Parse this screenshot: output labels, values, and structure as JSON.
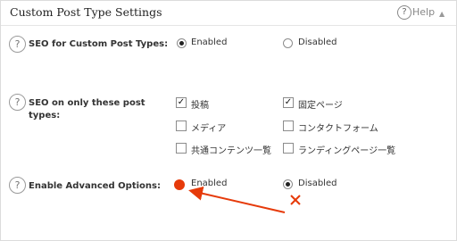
{
  "panel": {
    "title": "Custom Post Type Settings",
    "help_label": "Help"
  },
  "rows": [
    {
      "label_lines": [
        "SEO for Custom Post Types:"
      ],
      "options": [
        {
          "label": "Enabled",
          "type": "radio",
          "checked": true
        },
        {
          "label": "Disabled",
          "type": "radio",
          "checked": false
        }
      ]
    },
    {
      "label_lines": [
        "SEO on only these post",
        "types:"
      ],
      "options": [
        {
          "label": "投稿",
          "type": "checkbox",
          "checked": true
        },
        {
          "label": "固定ページ",
          "type": "checkbox",
          "checked": true
        },
        {
          "label": "メディア",
          "type": "checkbox",
          "checked": false
        },
        {
          "label": "コンタクトフォーム",
          "type": "checkbox",
          "checked": false
        },
        {
          "label": "共通コンテンツ一覧",
          "type": "checkbox",
          "checked": false
        },
        {
          "label": "ランディングページ一覧",
          "type": "checkbox",
          "checked": false
        }
      ]
    },
    {
      "label_lines": [
        "Enable Advanced Options:"
      ],
      "options": [
        {
          "label": "Enabled",
          "type": "radio",
          "checked": false,
          "highlighted": true
        },
        {
          "label": "Disabled",
          "type": "radio",
          "checked": true
        }
      ]
    }
  ],
  "annotations": {
    "highlight_color": "#e63a0a",
    "arrow_color": "#e63a0a",
    "cross_color": "#e63a0a"
  }
}
